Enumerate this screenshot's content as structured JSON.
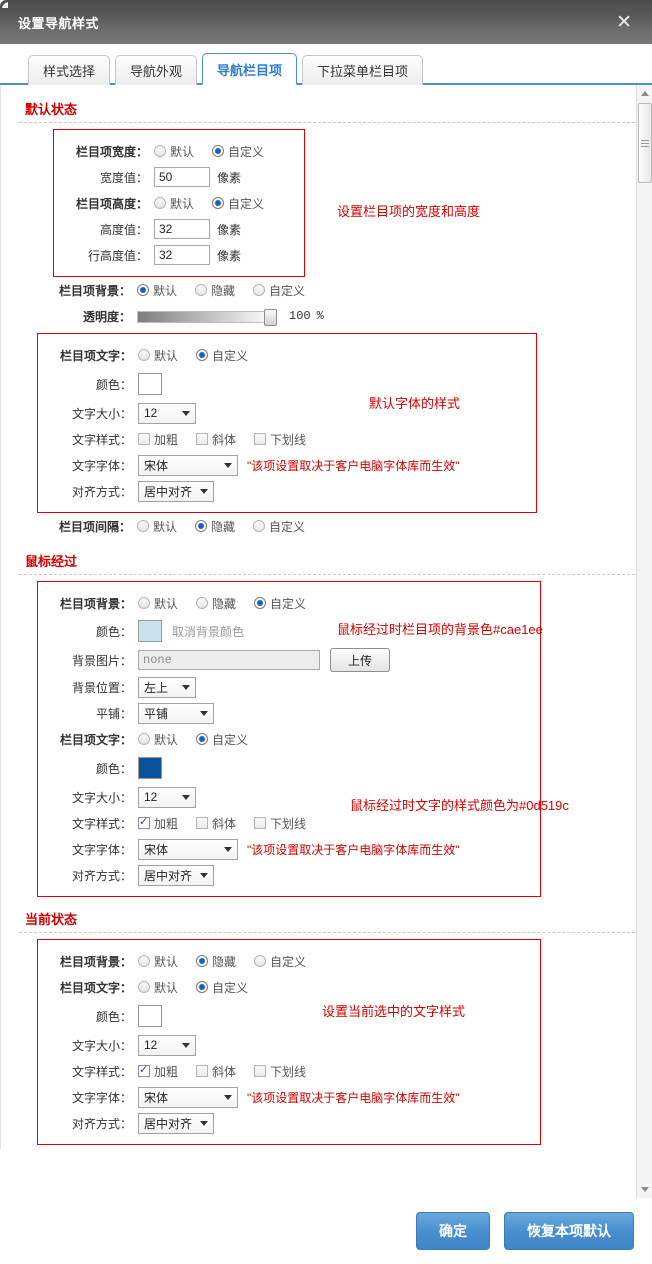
{
  "window": {
    "title": "设置导航样式",
    "close_icon": "✕"
  },
  "tabs": [
    {
      "label": "样式选择",
      "active": false
    },
    {
      "label": "导航外观",
      "active": false
    },
    {
      "label": "导航栏目项",
      "active": true
    },
    {
      "label": "下拉菜单栏目项",
      "active": false
    }
  ],
  "common": {
    "default": "默认",
    "custom": "自定义",
    "hidden": "隐藏",
    "pixel": "像素",
    "bold": "加粗",
    "italic": "斜体",
    "underline": "下划线",
    "font_note": "\"该项设置取决于客户电脑字体库而生效\"",
    "songti": "宋体",
    "center_align": "居中对齐",
    "size_12": "12",
    "upload": "上传",
    "cancel_bg_color": "取消背景颜色",
    "none": "none",
    "left_top": "左上",
    "tile": "平铺"
  },
  "labels": {
    "item_width": "栏目项宽度：",
    "width_value": "宽度值：",
    "item_height": "栏目项高度：",
    "height_value": "高度值：",
    "lineheight_value": "行高度值：",
    "item_bg": "栏目项背景：",
    "opacity": "透明度：",
    "item_text": "栏目项文字：",
    "color": "颜色：",
    "text_size": "文字大小：",
    "text_style": "文字样式：",
    "text_font": "文字字体：",
    "align": "对齐方式：",
    "item_gap": "栏目项间隔：",
    "bg_image": "背景图片：",
    "bg_position": "背景位置：",
    "bg_repeat": "平铺："
  },
  "default_state": {
    "title": "默认状态",
    "annotation_size": "设置栏目项的宽度和高度",
    "annotation_font": "默认字体的样式",
    "width_value": "50",
    "height_value": "32",
    "lineheight_value": "32",
    "opacity_value": "100",
    "opacity_unit": "%",
    "text_color": "#ffffff",
    "bg_mode": "默认",
    "gap_mode": "隐藏"
  },
  "hover_state": {
    "title": "鼠标经过",
    "annotation_bg": "鼠标经过时栏目项的背景色#cae1ee",
    "annotation_text": "鼠标经过时文字的样式颜色为#0d519c",
    "bg_color": "#cae1ee",
    "text_color": "#0d519c",
    "bg_image_value": "none",
    "bg_position_value": "左上",
    "bg_repeat_value": "平铺"
  },
  "current_state": {
    "title": "当前状态",
    "annotation_text": "设置当前选中的文字样式",
    "text_color": "#ffffff"
  },
  "footer": {
    "confirm": "确定",
    "reset": "恢复本项默认"
  }
}
